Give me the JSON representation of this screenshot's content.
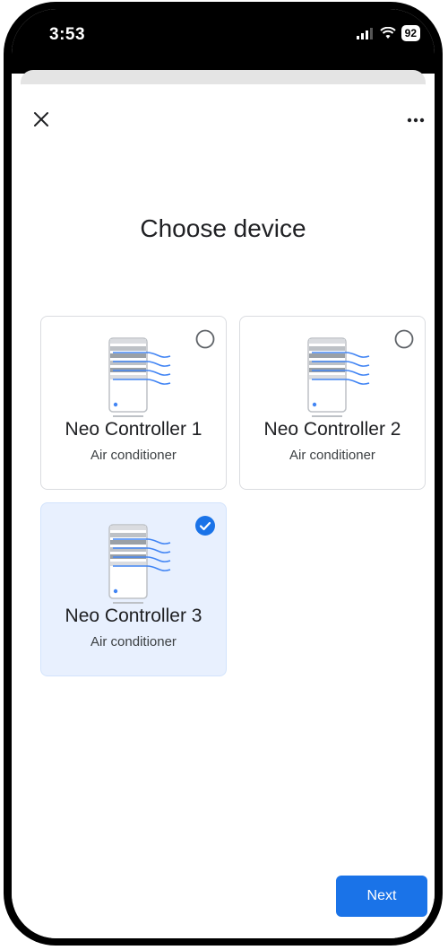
{
  "status_bar": {
    "time": "3:53",
    "battery": "92"
  },
  "header": {
    "close_icon": "close-icon",
    "more_icon": "more-horizontal-icon"
  },
  "page": {
    "title": "Choose device"
  },
  "devices": [
    {
      "name": "Neo Controller 1",
      "type": "Air conditioner",
      "selected": false
    },
    {
      "name": "Neo Controller 2",
      "type": "Air conditioner",
      "selected": false
    },
    {
      "name": "Neo Controller 3",
      "type": "Air conditioner",
      "selected": true
    }
  ],
  "footer": {
    "next_label": "Next"
  },
  "colors": {
    "accent": "#1a73e8",
    "selected_card_bg": "#e8f0fe",
    "device_gray": "#bdc1c6"
  }
}
